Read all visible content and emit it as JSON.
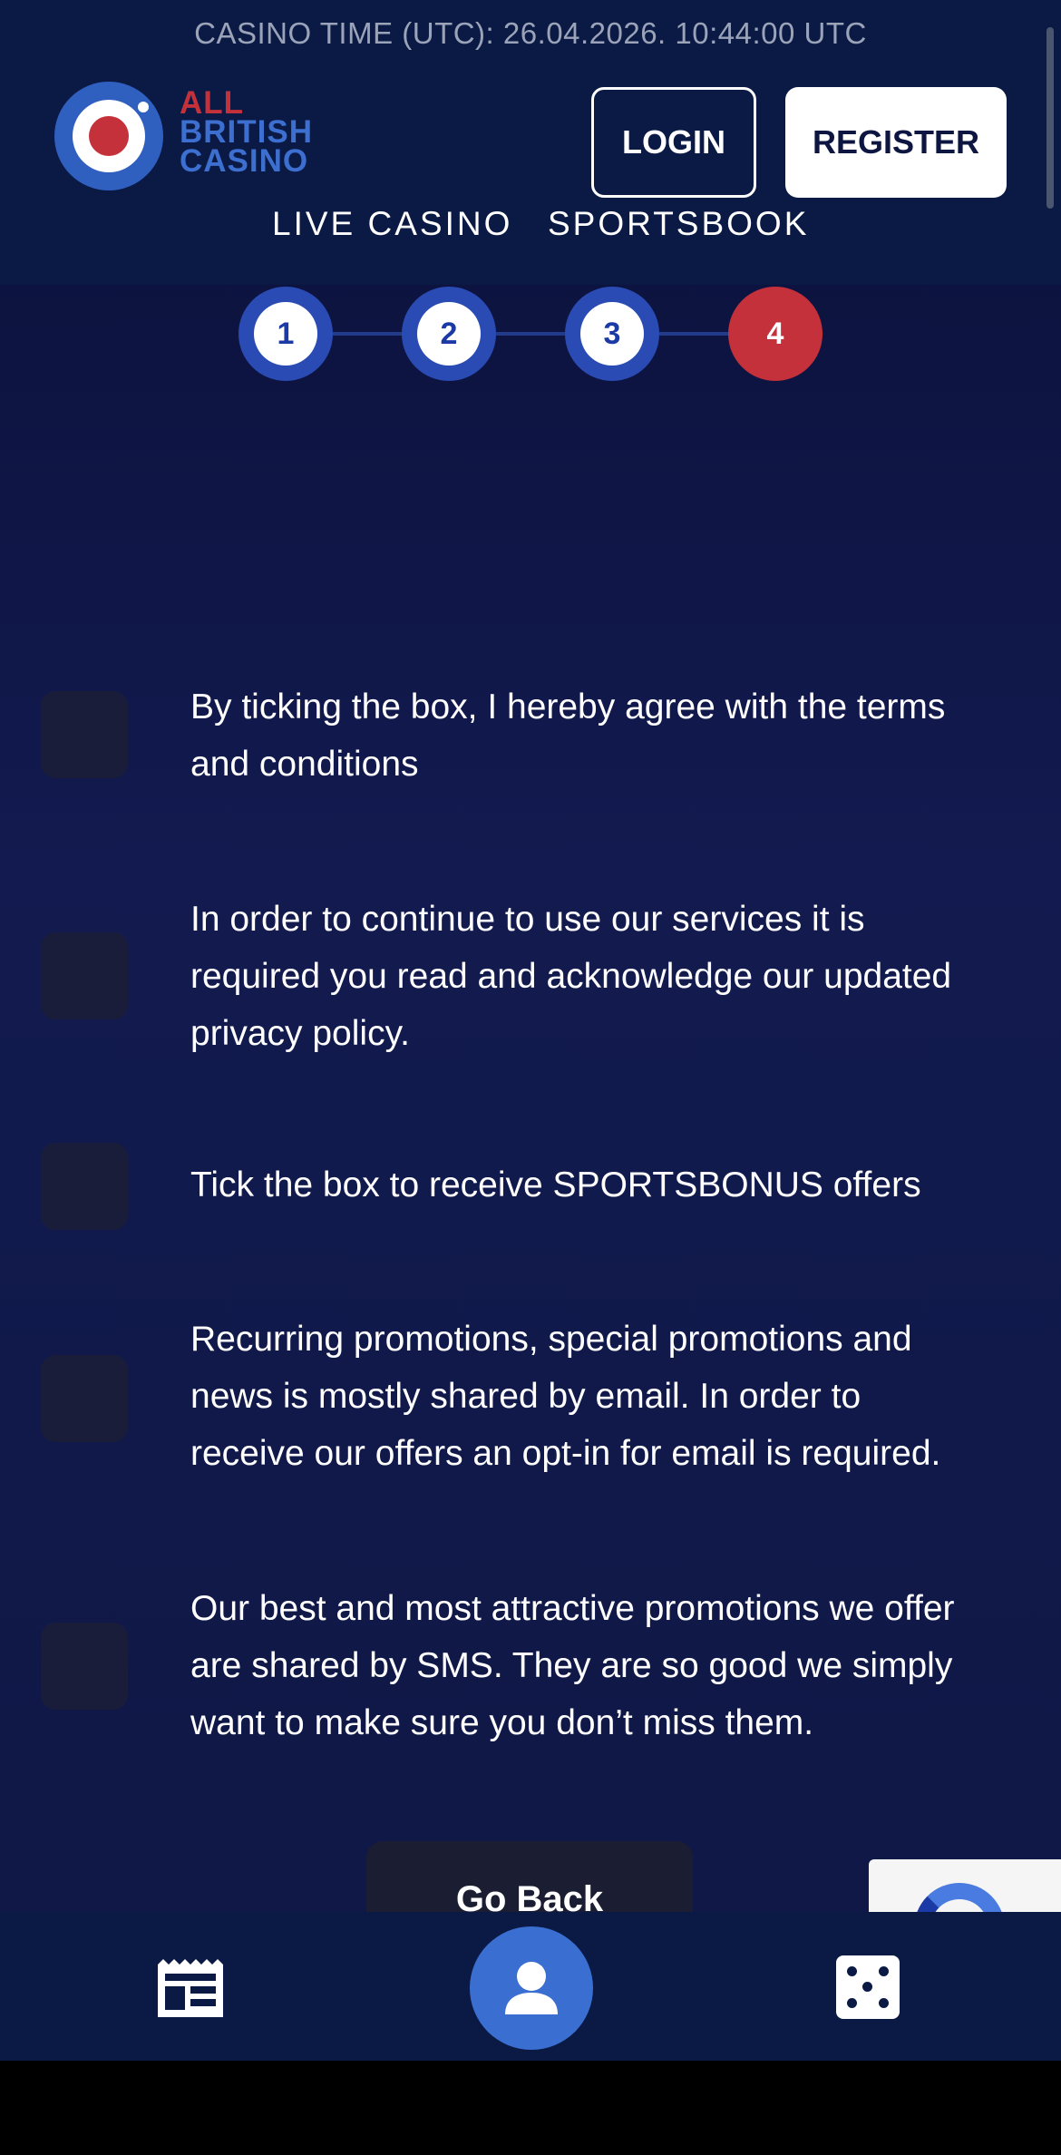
{
  "header": {
    "casino_time": "CASINO TIME (UTC): 26.04.2026. 10:44:00 UTC",
    "logo": {
      "line1": "ALL",
      "line2": "BRITISH",
      "line3": "CASINO"
    },
    "login_label": "LOGIN",
    "register_label": "REGISTER",
    "nav": [
      {
        "label": "LIVE CASINO"
      },
      {
        "label": "SPORTSBOOK"
      }
    ]
  },
  "steps": [
    {
      "label": "1",
      "state": "done"
    },
    {
      "label": "2",
      "state": "done"
    },
    {
      "label": "3",
      "state": "done"
    },
    {
      "label": "4",
      "state": "active"
    }
  ],
  "consents": [
    {
      "text": "By ticking the box, I hereby agree with the terms and conditions",
      "checked": false
    },
    {
      "text": "In order to continue to use our services it is required you read and acknowledge our updated privacy policy.",
      "checked": false
    },
    {
      "text": "Tick the box to receive SPORTSBONUS offers",
      "checked": false
    },
    {
      "text": "Recurring promotions, special promotions and news is mostly shared by email. In order to receive our offers an opt-in for email is required.",
      "checked": false
    },
    {
      "text": "Our best and most attractive promotions we offer are shared by SMS. They are so good we simply want to make sure you don’t miss them.",
      "checked": false
    }
  ],
  "go_back_label": "Go Back",
  "bottom_nav": {
    "left_icon": "news-icon",
    "center_icon": "user-icon",
    "right_icon": "dice-icon"
  },
  "colors": {
    "background": "#0d1541",
    "header": "#0b1a45",
    "accent_blue": "#2a4bb3",
    "accent_red": "#c4313a"
  }
}
